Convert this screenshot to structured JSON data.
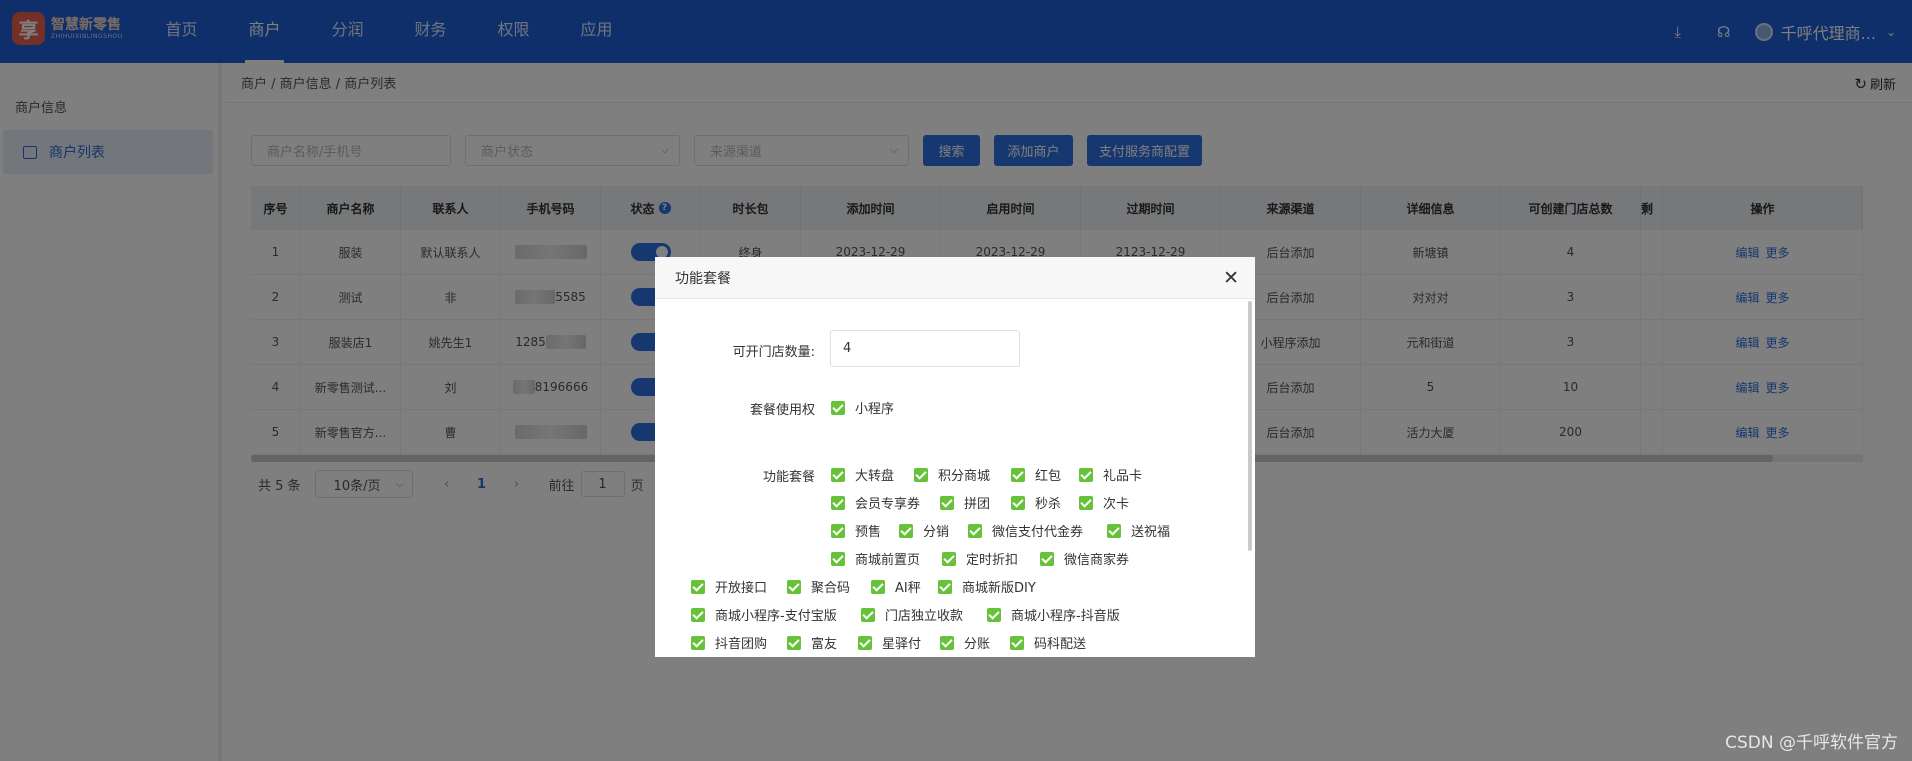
{
  "header": {
    "logo_mark": "享",
    "logo_cn": "智慧新零售",
    "logo_en": "ZHIHUIXINLINGSHOU",
    "nav": [
      "首页",
      "商户",
      "分润",
      "财务",
      "权限",
      "应用"
    ],
    "active_nav": "商户",
    "user_name": "千呼代理商..."
  },
  "sidebar": {
    "title": "商户信息",
    "items": [
      {
        "label": "商户列表"
      }
    ]
  },
  "breadcrumb": "商户 / 商户信息 / 商户列表",
  "refresh_label": "刷新",
  "filters": {
    "name_placeholder": "商户名称/手机号",
    "status_placeholder": "商户状态",
    "source_placeholder": "来源渠道"
  },
  "buttons": {
    "search": "搜索",
    "add": "添加商户",
    "pay_config": "支付服务商配置"
  },
  "table": {
    "columns": [
      "序号",
      "商户名称",
      "联系人",
      "手机号码",
      "状态",
      "时长包",
      "添加时间",
      "启用时间",
      "过期时间",
      "来源渠道",
      "详细信息",
      "可创建门店总数",
      "剩",
      "操作"
    ],
    "rows": [
      {
        "no": "1",
        "name": "服装",
        "contact": "默认联系人",
        "phone": "",
        "duration": "终身",
        "add_time": "2023-12-29",
        "enable_time": "2023-12-29",
        "expire_time": "2123-12-29",
        "source": "后台添加",
        "detail": "新塘镇",
        "stores": "4"
      },
      {
        "no": "2",
        "name": "测试",
        "contact": "非",
        "phone": "5585",
        "duration": "",
        "add_time": "",
        "enable_time": "",
        "expire_time": "",
        "source": "后台添加",
        "detail": "对对对",
        "stores": "3"
      },
      {
        "no": "3",
        "name": "服装店1",
        "contact": "姚先生1",
        "phone": "1285",
        "duration": "",
        "add_time": "",
        "enable_time": "",
        "expire_time": "",
        "source": "小程序添加",
        "detail": "元和街道",
        "stores": "3"
      },
      {
        "no": "4",
        "name": "新零售测试...",
        "contact": "刘",
        "phone": "8196666",
        "duration": "",
        "add_time": "",
        "enable_time": "",
        "expire_time": "",
        "source": "后台添加",
        "detail": "5",
        "stores": "10"
      },
      {
        "no": "5",
        "name": "新零售官方...",
        "contact": "曹",
        "phone": "",
        "duration": "",
        "add_time": "",
        "enable_time": "",
        "expire_time": "",
        "source": "后台添加",
        "detail": "活力大厦",
        "stores": "200"
      }
    ],
    "action_edit": "编辑",
    "action_more": "更多"
  },
  "pager": {
    "total": "共 5 条",
    "page_size": "10条/页",
    "current": "1",
    "goto_label": "前往",
    "goto_value": "1",
    "page_unit": "页"
  },
  "dialog": {
    "title": "功能套餐",
    "store_count_label": "可开门店数量:",
    "store_count_value": "4",
    "usage_label": "套餐使用权",
    "usage_items": [
      {
        "label": "小程序",
        "checked": true
      }
    ],
    "package_label": "功能套餐",
    "package_items": [
      {
        "label": "大转盘",
        "checked": true
      },
      {
        "label": "积分商城",
        "checked": true
      },
      {
        "label": "红包",
        "checked": true
      },
      {
        "label": "礼品卡",
        "checked": true
      },
      {
        "label": "会员专享券",
        "checked": true
      },
      {
        "label": "拼团",
        "checked": true
      },
      {
        "label": "秒杀",
        "checked": true
      },
      {
        "label": "次卡",
        "checked": true
      },
      {
        "label": "预售",
        "checked": true
      },
      {
        "label": "分销",
        "checked": true
      },
      {
        "label": "微信支付代金券",
        "checked": true
      },
      {
        "label": "送祝福",
        "checked": true
      },
      {
        "label": "商城前置页",
        "checked": true
      },
      {
        "label": "定时折扣",
        "checked": true
      },
      {
        "label": "微信商家券",
        "checked": true
      },
      {
        "label": "开放接口",
        "checked": true
      },
      {
        "label": "聚合码",
        "checked": true
      },
      {
        "label": "AI秤",
        "checked": true
      },
      {
        "label": "商城新版DIY",
        "checked": true
      },
      {
        "label": "商城小程序-支付宝版",
        "checked": true
      },
      {
        "label": "门店独立收款",
        "checked": true
      },
      {
        "label": "商城小程序-抖音版",
        "checked": true
      },
      {
        "label": "抖音团购",
        "checked": true
      },
      {
        "label": "富友",
        "checked": true
      },
      {
        "label": "星驿付",
        "checked": true
      },
      {
        "label": "分账",
        "checked": true
      },
      {
        "label": "码科配送",
        "checked": true
      }
    ]
  },
  "watermark": "CSDN @千呼软件官方",
  "colors": {
    "primary": "#1e5fd6",
    "button": "#2d6fdf",
    "checkbox": "#67c23a"
  }
}
